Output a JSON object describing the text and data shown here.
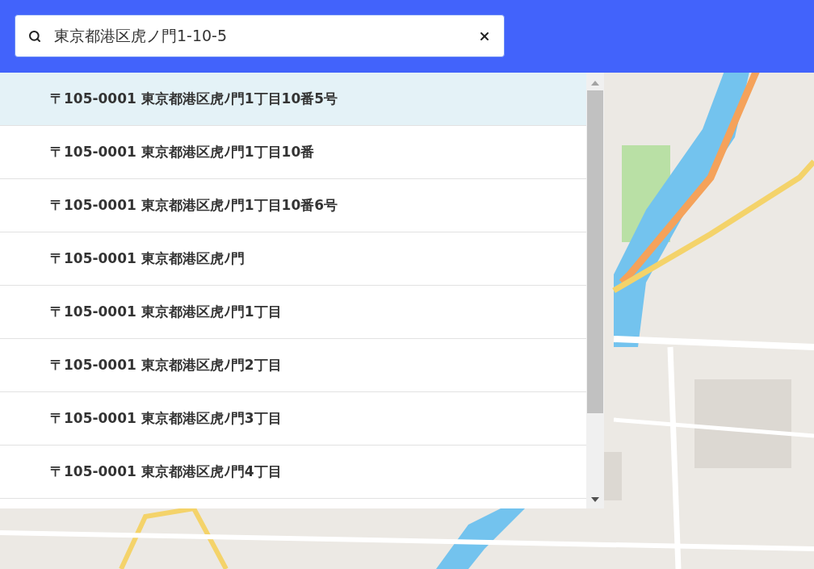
{
  "search": {
    "value": "東京都港区虎ノ門1-10-5"
  },
  "suggestions": [
    {
      "label": "〒105-0001 東京都港区虎ﾉ門1丁目10番5号",
      "selected": true
    },
    {
      "label": "〒105-0001 東京都港区虎ﾉ門1丁目10番",
      "selected": false
    },
    {
      "label": "〒105-0001 東京都港区虎ﾉ門1丁目10番6号",
      "selected": false
    },
    {
      "label": "〒105-0001 東京都港区虎ﾉ門",
      "selected": false
    },
    {
      "label": "〒105-0001 東京都港区虎ﾉ門1丁目",
      "selected": false
    },
    {
      "label": "〒105-0001 東京都港区虎ﾉ門2丁目",
      "selected": false
    },
    {
      "label": "〒105-0001 東京都港区虎ﾉ門3丁目",
      "selected": false
    },
    {
      "label": "〒105-0001 東京都港区虎ﾉ門4丁目",
      "selected": false
    }
  ]
}
